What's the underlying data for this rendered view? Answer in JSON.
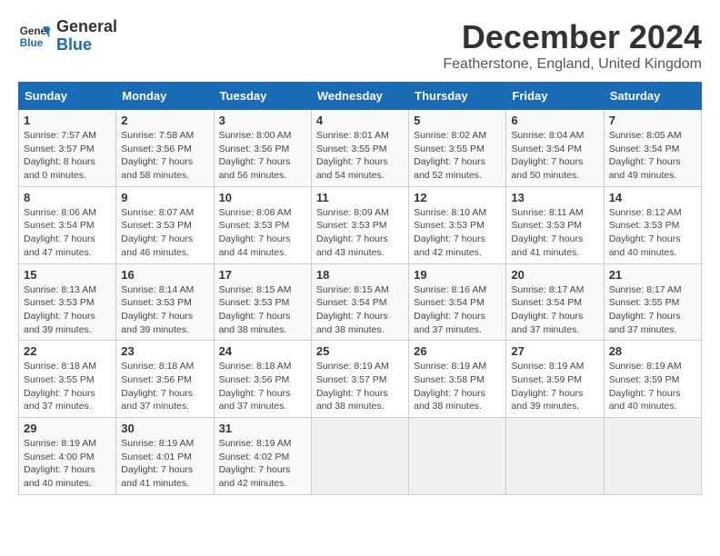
{
  "header": {
    "logo_line1": "General",
    "logo_line2": "Blue",
    "month": "December 2024",
    "location": "Featherstone, England, United Kingdom"
  },
  "weekdays": [
    "Sunday",
    "Monday",
    "Tuesday",
    "Wednesday",
    "Thursday",
    "Friday",
    "Saturday"
  ],
  "weeks": [
    [
      {
        "day": "1",
        "sunrise": "7:57 AM",
        "sunset": "3:57 PM",
        "daylight": "8 hours and 0 minutes."
      },
      {
        "day": "2",
        "sunrise": "7:58 AM",
        "sunset": "3:56 PM",
        "daylight": "7 hours and 58 minutes."
      },
      {
        "day": "3",
        "sunrise": "8:00 AM",
        "sunset": "3:56 PM",
        "daylight": "7 hours and 56 minutes."
      },
      {
        "day": "4",
        "sunrise": "8:01 AM",
        "sunset": "3:55 PM",
        "daylight": "7 hours and 54 minutes."
      },
      {
        "day": "5",
        "sunrise": "8:02 AM",
        "sunset": "3:55 PM",
        "daylight": "7 hours and 52 minutes."
      },
      {
        "day": "6",
        "sunrise": "8:04 AM",
        "sunset": "3:54 PM",
        "daylight": "7 hours and 50 minutes."
      },
      {
        "day": "7",
        "sunrise": "8:05 AM",
        "sunset": "3:54 PM",
        "daylight": "7 hours and 49 minutes."
      }
    ],
    [
      {
        "day": "8",
        "sunrise": "8:06 AM",
        "sunset": "3:54 PM",
        "daylight": "7 hours and 47 minutes."
      },
      {
        "day": "9",
        "sunrise": "8:07 AM",
        "sunset": "3:53 PM",
        "daylight": "7 hours and 46 minutes."
      },
      {
        "day": "10",
        "sunrise": "8:08 AM",
        "sunset": "3:53 PM",
        "daylight": "7 hours and 44 minutes."
      },
      {
        "day": "11",
        "sunrise": "8:09 AM",
        "sunset": "3:53 PM",
        "daylight": "7 hours and 43 minutes."
      },
      {
        "day": "12",
        "sunrise": "8:10 AM",
        "sunset": "3:53 PM",
        "daylight": "7 hours and 42 minutes."
      },
      {
        "day": "13",
        "sunrise": "8:11 AM",
        "sunset": "3:53 PM",
        "daylight": "7 hours and 41 minutes."
      },
      {
        "day": "14",
        "sunrise": "8:12 AM",
        "sunset": "3:53 PM",
        "daylight": "7 hours and 40 minutes."
      }
    ],
    [
      {
        "day": "15",
        "sunrise": "8:13 AM",
        "sunset": "3:53 PM",
        "daylight": "7 hours and 39 minutes."
      },
      {
        "day": "16",
        "sunrise": "8:14 AM",
        "sunset": "3:53 PM",
        "daylight": "7 hours and 39 minutes."
      },
      {
        "day": "17",
        "sunrise": "8:15 AM",
        "sunset": "3:53 PM",
        "daylight": "7 hours and 38 minutes."
      },
      {
        "day": "18",
        "sunrise": "8:15 AM",
        "sunset": "3:54 PM",
        "daylight": "7 hours and 38 minutes."
      },
      {
        "day": "19",
        "sunrise": "8:16 AM",
        "sunset": "3:54 PM",
        "daylight": "7 hours and 37 minutes."
      },
      {
        "day": "20",
        "sunrise": "8:17 AM",
        "sunset": "3:54 PM",
        "daylight": "7 hours and 37 minutes."
      },
      {
        "day": "21",
        "sunrise": "8:17 AM",
        "sunset": "3:55 PM",
        "daylight": "7 hours and 37 minutes."
      }
    ],
    [
      {
        "day": "22",
        "sunrise": "8:18 AM",
        "sunset": "3:55 PM",
        "daylight": "7 hours and 37 minutes."
      },
      {
        "day": "23",
        "sunrise": "8:18 AM",
        "sunset": "3:56 PM",
        "daylight": "7 hours and 37 minutes."
      },
      {
        "day": "24",
        "sunrise": "8:18 AM",
        "sunset": "3:56 PM",
        "daylight": "7 hours and 37 minutes."
      },
      {
        "day": "25",
        "sunrise": "8:19 AM",
        "sunset": "3:57 PM",
        "daylight": "7 hours and 38 minutes."
      },
      {
        "day": "26",
        "sunrise": "8:19 AM",
        "sunset": "3:58 PM",
        "daylight": "7 hours and 38 minutes."
      },
      {
        "day": "27",
        "sunrise": "8:19 AM",
        "sunset": "3:59 PM",
        "daylight": "7 hours and 39 minutes."
      },
      {
        "day": "28",
        "sunrise": "8:19 AM",
        "sunset": "3:59 PM",
        "daylight": "7 hours and 40 minutes."
      }
    ],
    [
      {
        "day": "29",
        "sunrise": "8:19 AM",
        "sunset": "4:00 PM",
        "daylight": "7 hours and 40 minutes."
      },
      {
        "day": "30",
        "sunrise": "8:19 AM",
        "sunset": "4:01 PM",
        "daylight": "7 hours and 41 minutes."
      },
      {
        "day": "31",
        "sunrise": "8:19 AM",
        "sunset": "4:02 PM",
        "daylight": "7 hours and 42 minutes."
      },
      null,
      null,
      null,
      null
    ]
  ]
}
